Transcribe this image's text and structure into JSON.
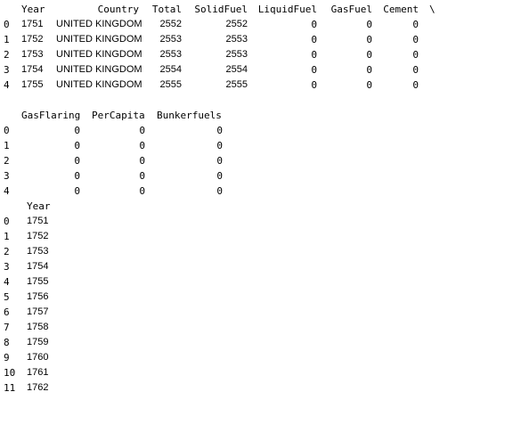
{
  "output": {
    "table1": {
      "headers": [
        "Year",
        "Country",
        "Total",
        "SolidFuel",
        "LiquidFuel",
        "GasFuel",
        "Cement",
        "\\"
      ],
      "rows": [
        {
          "index": "0",
          "year": "1751",
          "country": "UNITED KINGDOM",
          "total": "2552",
          "solid": "2552",
          "liquid": "0",
          "gas": "0",
          "cement": "0"
        },
        {
          "index": "1",
          "year": "1752",
          "country": "UNITED KINGDOM",
          "total": "2553",
          "solid": "2553",
          "liquid": "0",
          "gas": "0",
          "cement": "0"
        },
        {
          "index": "2",
          "year": "1753",
          "country": "UNITED KINGDOM",
          "total": "2553",
          "solid": "2553",
          "liquid": "0",
          "gas": "0",
          "cement": "0"
        },
        {
          "index": "3",
          "year": "1754",
          "country": "UNITED KINGDOM",
          "total": "2554",
          "solid": "2554",
          "liquid": "0",
          "gas": "0",
          "cement": "0"
        },
        {
          "index": "4",
          "year": "1755",
          "country": "UNITED KINGDOM",
          "total": "2555",
          "solid": "2555",
          "liquid": "0",
          "gas": "0",
          "cement": "0"
        }
      ]
    },
    "table2": {
      "headers": [
        "GasFlaring",
        "PerCapita",
        "Bunkerfuels"
      ],
      "rows": [
        {
          "index": "0",
          "flaring": "0",
          "percapita": "0",
          "bunker": "0"
        },
        {
          "index": "1",
          "flaring": "0",
          "percapita": "0",
          "bunker": "0"
        },
        {
          "index": "2",
          "flaring": "0",
          "percapita": "0",
          "bunker": "0"
        },
        {
          "index": "3",
          "flaring": "0",
          "percapita": "0",
          "bunker": "0"
        },
        {
          "index": "4",
          "flaring": "0",
          "percapita": "0",
          "bunker": "0"
        }
      ]
    },
    "table3": {
      "headers": [
        "Year"
      ],
      "rows": [
        {
          "index": "0",
          "year": "1751"
        },
        {
          "index": "1",
          "year": "1752"
        },
        {
          "index": "2",
          "year": "1753"
        },
        {
          "index": "3",
          "year": "1754"
        },
        {
          "index": "4",
          "year": "1755"
        },
        {
          "index": "5",
          "year": "1756"
        },
        {
          "index": "6",
          "year": "1757"
        },
        {
          "index": "7",
          "year": "1758"
        },
        {
          "index": "8",
          "year": "1759"
        },
        {
          "index": "9",
          "year": "1760"
        },
        {
          "index": "10",
          "year": "1761"
        },
        {
          "index": "11",
          "year": "1762"
        }
      ]
    }
  }
}
